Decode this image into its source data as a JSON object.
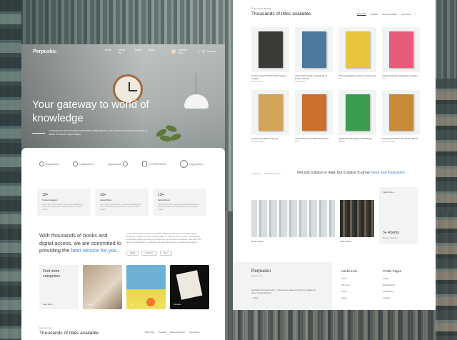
{
  "left": {
    "nav": {
      "logo": "Perpusku.",
      "links": [
        "Home",
        "About us",
        "Space",
        "Room"
      ],
      "user": "Kathleen Arzo",
      "donate": "Donation"
    },
    "hero": {
      "headline": "Your gateway to world of knowledge",
      "subtext": "Lorem ipsum dolor sit amet, consectetur adipiscing elit, sed do eiusmod tempor incididunt ut labore et dolore magna aliqua."
    },
    "logos": [
      "logoipsum",
      "Logoipsum",
      "logo ipsum",
      "LOGOIPSUM",
      "logo ipsum"
    ],
    "stats": [
      {
        "num": "12+",
        "label": "Trusted Category",
        "desc": "Lorem ipsum dolor sit amet, consectetur adipiscing elit, sed do eiusmod tempor incididunt ut labore et dolore magna."
      },
      {
        "num": "12+",
        "label": "Variant Book",
        "desc": "Lorem ipsum dolor sit amet, consectetur adipiscing elit, sed do eiusmod tempor incididunt ut labore et dolore magna."
      },
      {
        "num": "12+",
        "label": "Variant Room",
        "desc": "Lorem ipsum dolor sit amet, consectetur adipiscing elit, sed do eiusmod tempor incididunt ut labore et dolore magna."
      }
    ],
    "intro": {
      "pre": "With thousands of books and digital access, we are committed to providing the ",
      "highlight": "best service for you.",
      "body": "Lorem ipsum dolor sit amet, consectetur adipiscing elit, sed do eiusmod tempor incididunt ut labore et dolore magna aliqua. Ut enim ad minim veniam, quis nostrud exercitation ullamco laboris nisi ut aliquip ex ea commodo consequat. Duis aute irure dolor in reprehenderit in voluptate velit esse cillum dolore eu fugiat nulla pariatur.",
      "tags": [
        "Digital",
        "Collection",
        "Room"
      ]
    },
    "categories": {
      "title": "Find more categories",
      "view": "View More  →",
      "labels": [
        "Culinary",
        "Arts",
        "Literature"
      ]
    },
    "bottom": {
      "eyebrow": "Experiencing",
      "title": "Thousands of titles available",
      "tabs": [
        "Most Visit",
        "Popular",
        "Recommended",
        "Upcoming  ›"
      ]
    }
  },
  "right": {
    "eyebrow": "Enjoy book reading",
    "title": "Thousands of titles available",
    "tabs": [
      "Most Visit",
      "Popular",
      "Recommended",
      "Upcoming"
    ],
    "tabs_more": "›",
    "books": [
      {
        "title": "A Short History Of The World (Agnes Knight)",
        "author": "Peter Gordon",
        "color": "#3a3a36"
      },
      {
        "title": "Alice's Adventures in Wonderland (Lewis Carroll)",
        "author": "Lewis Carroll",
        "color": "#4d7a9c"
      },
      {
        "title": "1001 Pengetahuan Modern Untuk Anak",
        "author": "Sita",
        "color": "#e7c43c"
      },
      {
        "title": "Aneka Kerhiasan Rangkaian Tiringan",
        "author": "Yuni",
        "color": "#e85a7a"
      },
      {
        "title": "Aneka Cara Olahan Jagung",
        "author": "Tim Pembangkit",
        "color": "#d1a45a"
      },
      {
        "title": "Aneka Pilihan Dari Dikit Pelamahan",
        "author": "Sita",
        "color": "#c9702e"
      },
      {
        "title": "Agroforestry Budidaya Lidah Buaya",
        "author": "Agrotek",
        "color": "#3c9c4e"
      },
      {
        "title": "Aneka Kreasi Baru Dari Bahan Bekas",
        "author": "Tim Pembangkit",
        "color": "#c68a38"
      }
    ],
    "tagline": {
      "label": "Innovative Space",
      "pre": "Not just a place to read, but a space to grow ",
      "highlight": "ideas and inspiration."
    },
    "rooms": {
      "a": "Room Space",
      "b": "Room Video",
      "view": "View More  →",
      "count": "3+ Rooms",
      "count_sub": "Browse & Explore"
    },
    "footer": {
      "brand": "Perpusku",
      "sub": "Bandung City",
      "desc": "Inspiration often begins with — I discover the pages of a book, by a digital and more, or book whenever.",
      "back": "←  Back",
      "col1": {
        "heading": "Useful Link",
        "items": [
          "Home",
          "About Us",
          "Room",
          "Space"
        ]
      },
      "col2": {
        "heading": "Profile Pages",
        "items": [
          "Profile",
          "My Bookshelf",
          "Notifications",
          "Settings"
        ]
      }
    }
  }
}
